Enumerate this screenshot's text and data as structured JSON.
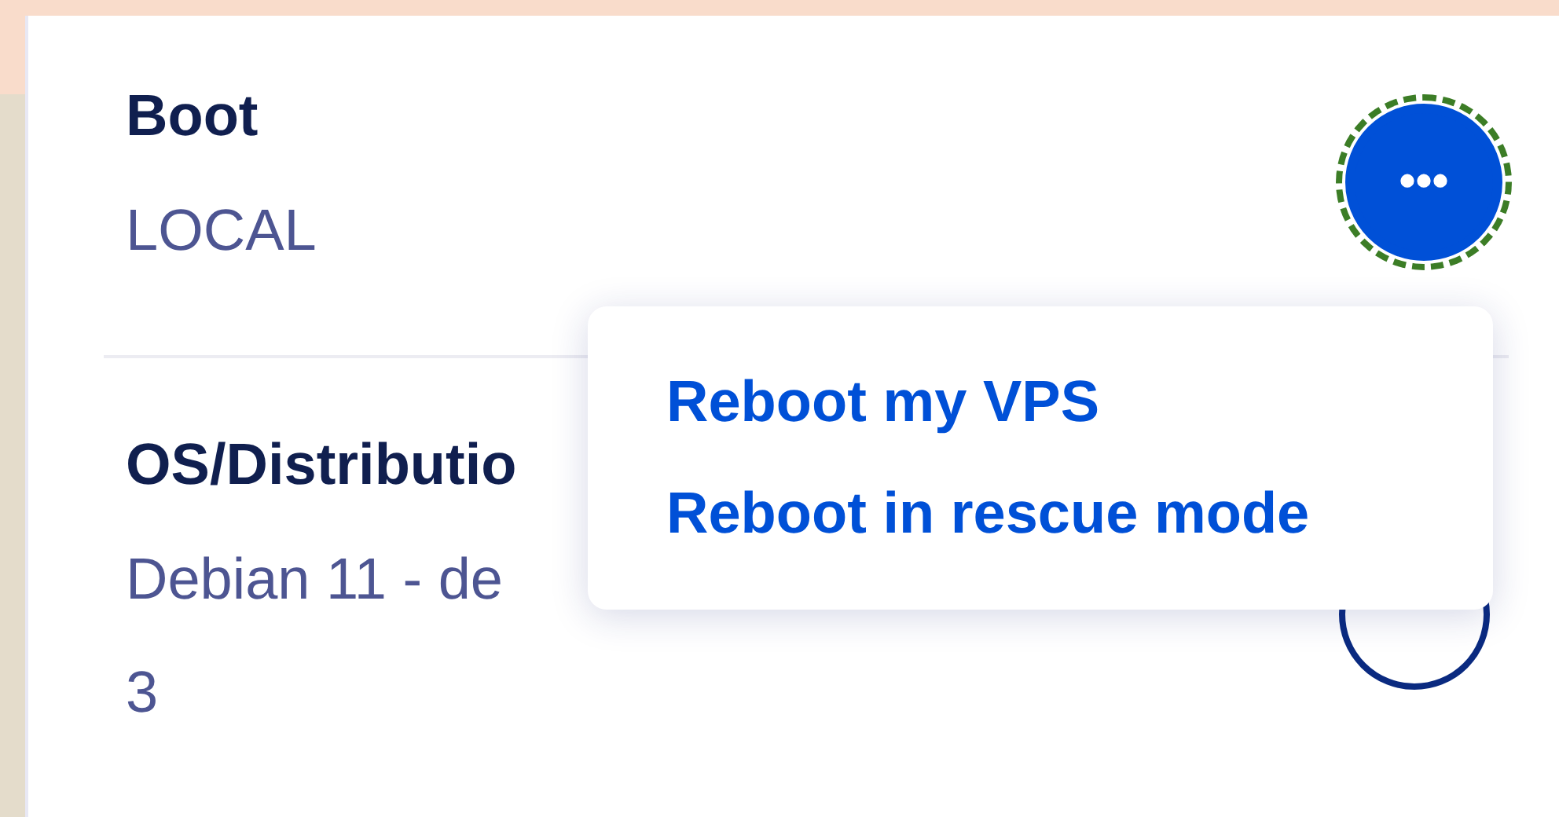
{
  "sections": [
    {
      "label": "Boot",
      "lines": [
        "LOCAL"
      ],
      "kind": "filled"
    },
    {
      "label": "OS/Distributio",
      "lines": [
        "Debian 11 - de",
        "3"
      ],
      "kind": "outlined"
    }
  ],
  "more_button": {
    "icon": "•••",
    "focused": true
  },
  "menu": {
    "open": true,
    "items": [
      {
        "label": "Reboot my VPS"
      },
      {
        "label": "Reboot in rescue mode"
      }
    ]
  }
}
